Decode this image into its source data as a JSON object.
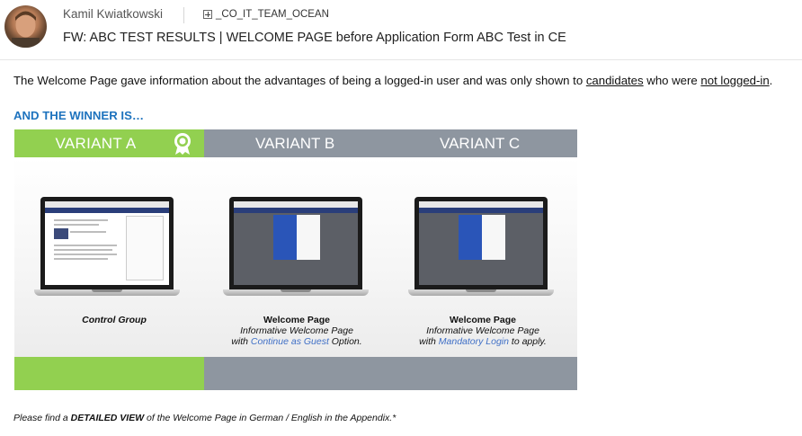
{
  "header": {
    "sender": "Kamil Kwiatkowski",
    "recipient": "_CO_IT_TEAM_OCEAN",
    "subject": "FW: ABC TEST RESULTS | WELCOME PAGE before Application Form ABC Test in CE"
  },
  "body": {
    "intro_prefix": "The Welcome Page gave information about the advantages of being a logged-in user and was only shown to ",
    "intro_link1": "candidates",
    "intro_middle": " who were ",
    "intro_link2": "not logged-in",
    "intro_suffix": ".",
    "winner_heading": "AND THE WINNER IS…",
    "footnote_prefix": "Please find a ",
    "footnote_bold": "DETAILED VIEW",
    "footnote_suffix": " of the Welcome Page in German / English in the Appendix.*"
  },
  "figure": {
    "variant_a": "VARIANT A",
    "variant_b": "VARIANT B",
    "variant_c": "VARIANT C",
    "caption_a": "Control Group",
    "caption_b_title": "Welcome Page",
    "caption_b_line2": "Informative Welcome Page",
    "caption_b_line3_pre": "with ",
    "caption_b_link": "Continue as Guest",
    "caption_b_line3_post": " Option.",
    "caption_c_title": "Welcome Page",
    "caption_c_line2": "Informative Welcome Page",
    "caption_c_line3_pre": "with ",
    "caption_c_link": "Mandatory Login",
    "caption_c_line3_post": " to apply."
  },
  "colors": {
    "winner_green": "#92d050",
    "grey_bar": "#8e96a0",
    "heading_blue": "#1e73be",
    "link_blue": "#3f6fc6"
  },
  "icons": [
    "avatar",
    "expand-icon",
    "award-ribbon-icon"
  ]
}
